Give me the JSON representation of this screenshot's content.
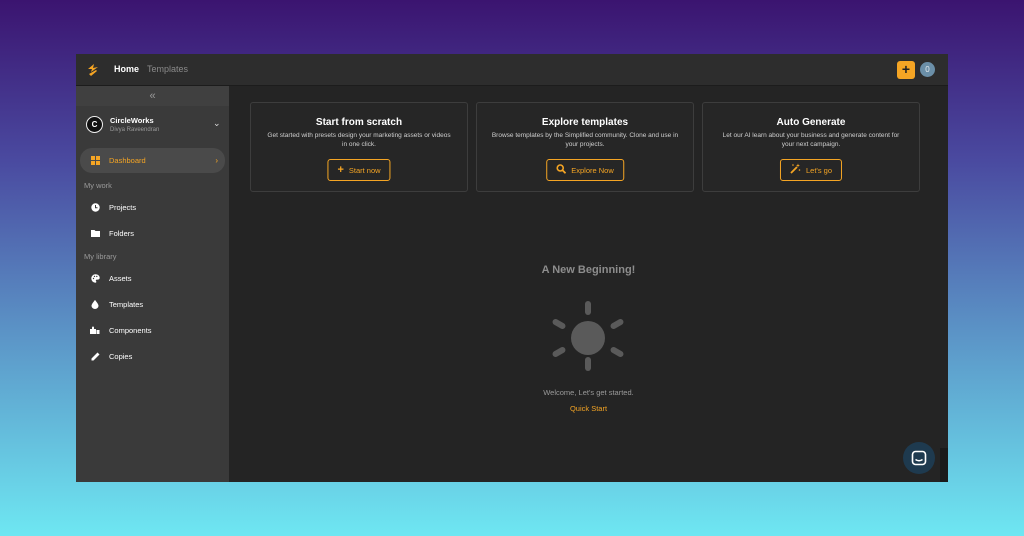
{
  "topbar": {
    "nav_home": "Home",
    "nav_templates": "Templates",
    "add_label": "+",
    "count": "0"
  },
  "sidebar": {
    "collapse": "«",
    "workspace_initial": "C",
    "workspace_name": "CircleWorks",
    "workspace_user": "Divya Raveendran",
    "dashboard": "Dashboard",
    "section_work": "My work",
    "projects": "Projects",
    "folders": "Folders",
    "section_library": "My library",
    "assets": "Assets",
    "templates": "Templates",
    "components": "Components",
    "copies": "Copies"
  },
  "cards": [
    {
      "title": "Start from scratch",
      "desc": "Get started with presets design your marketing assets or videos in one click.",
      "button": "Start now",
      "icon": "plus-icon"
    },
    {
      "title": "Explore templates",
      "desc": "Browse templates by the Simplified community. Clone and use in your projects.",
      "button": "Explore Now",
      "icon": "search-icon"
    },
    {
      "title": "Auto Generate",
      "desc": "Let our AI learn about your business and generate content for your next campaign.",
      "button": "Let's go",
      "icon": "magic-wand-icon"
    }
  ],
  "empty_state": {
    "title": "A New Beginning!",
    "welcome": "Welcome, Let's get started.",
    "quick_start": "Quick Start"
  },
  "colors": {
    "accent": "#f5a524",
    "sidebar": "#3a3a3a",
    "main": "#242424"
  }
}
